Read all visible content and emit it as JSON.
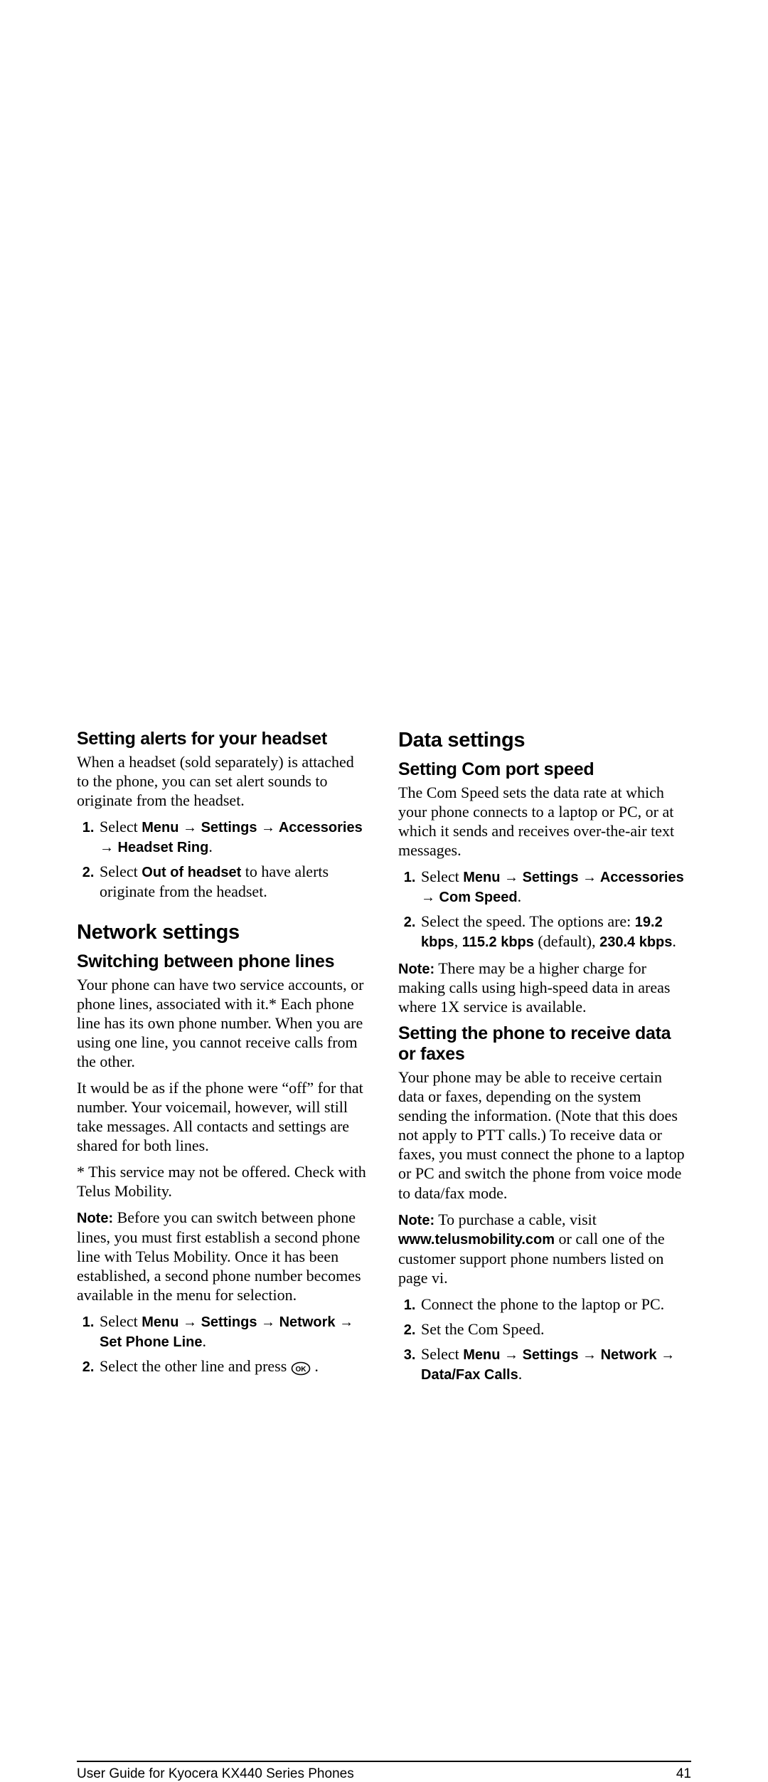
{
  "col1": {
    "h_headset": "Setting alerts for your headset",
    "headset_intro": "When a headset (sold separately) is attached to the phone, you can set alert sounds to originate from the headset.",
    "headset_step1_pre": "Select ",
    "headset_step1_b": "Menu → Settings → Accessories → Headset Ring",
    "headset_step1_post": ".",
    "headset_step2_pre": "Select ",
    "headset_step2_b": "Out of headset",
    "headset_step2_post": " to have alerts originate from the headset.",
    "h_network": "Network settings",
    "h_switch": "Switching between phone lines",
    "switch_p1": "Your phone can have two service accounts, or phone lines, associated with it.* Each phone line has its own phone number. When you are using one line, you cannot receive calls from the other.",
    "switch_p2": "It would be as if the phone were “off” for that number. Your voicemail, however, will still take messages. All contacts and settings are shared for both lines.",
    "switch_p3": "* This service may not be offered. Check with Telus Mobility.",
    "switch_note_b": "Note:",
    "switch_note": "  Before you can switch between phone lines, you must first establish a second phone line with Telus Mobility. Once it has been established, a second phone number becomes available in the menu for selection.",
    "switch_step1_pre": "Select ",
    "switch_step1_b": "Menu → Settings → Network → Set Phone Line",
    "switch_step1_post": ".",
    "switch_step2_pre": "Select the other line and press  ",
    "switch_step2_post": " ."
  },
  "col2": {
    "h_data": "Data settings",
    "h_com": "Setting Com port speed",
    "com_intro": "The Com Speed sets the data rate at which your phone connects to a laptop or PC, or at which it sends and receives over-the-air text messages.",
    "com_step1_pre": "Select ",
    "com_step1_b": "Menu → Settings → Accessories → Com Speed",
    "com_step1_post": ".",
    "com_step2_pre": "Select the speed. The options are: ",
    "com_step2_b1": "19.2 kbps",
    "com_step2_mid1": ", ",
    "com_step2_b2": "115.2 kbps",
    "com_step2_mid2": " (default), ",
    "com_step2_b3": "230.4 kbps",
    "com_step2_post": ".",
    "com_note_b": "Note:",
    "com_note": "  There may be a higher charge for making calls using high-speed data in areas where 1X service is available.",
    "h_datafax": "Setting the phone to receive data or faxes",
    "datafax_p1": "Your phone may be able to receive certain data or faxes, depending on the system sending the information. (Note that this does not apply to PTT calls.) To receive data or faxes, you must connect the phone to a laptop or PC and switch the phone from voice mode to data/fax mode.",
    "datafax_note_b": "Note:",
    "datafax_note_pre": "  To purchase a cable, visit ",
    "datafax_note_b2": "www.telusmobility.com",
    "datafax_note_post": " or call one of the customer support phone numbers listed on page vi.",
    "df_step1": "Connect the phone to the laptop or PC.",
    "df_step2": "Set the Com Speed.",
    "df_step3_pre": "Select ",
    "df_step3_b": "Menu → Settings → Network → Data/Fax Calls",
    "df_step3_post": "."
  },
  "footer": {
    "left": "User Guide for Kyocera KX440 Series Phones",
    "right": "41"
  }
}
